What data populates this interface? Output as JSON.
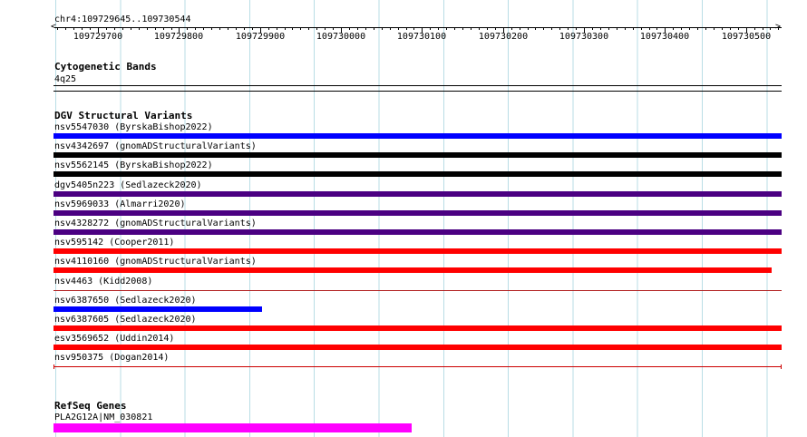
{
  "ruler": {
    "location": "chr4:109729645..109730544",
    "start": 109729645,
    "end": 109730544,
    "tick_labels": [
      "109729700",
      "109729800",
      "109729900",
      "109730000",
      "109730100",
      "109730200",
      "109730300",
      "109730400",
      "109730500"
    ],
    "tick_values": [
      109729700,
      109729800,
      109729900,
      109730000,
      109730100,
      109730200,
      109730300,
      109730400,
      109730500
    ]
  },
  "cytobands": {
    "title": "Cytogenetic Bands",
    "band": "4q25"
  },
  "dgv": {
    "title": "DGV Structural Variants",
    "variants": [
      {
        "label": "nsv5547030 (ByrskaBishop2022)",
        "color": "#0000ff",
        "style": "thick",
        "start_frac": 0.0,
        "end_frac": 1.0
      },
      {
        "label": "nsv4342697 (gnomADStructuralVariants)",
        "color": "#000000",
        "style": "thick",
        "start_frac": 0.0,
        "end_frac": 1.0
      },
      {
        "label": "nsv5562145 (ByrskaBishop2022)",
        "color": "#000000",
        "style": "thick",
        "start_frac": 0.0,
        "end_frac": 1.0
      },
      {
        "label": "dgv5405n223 (Sedlazeck2020)",
        "color": "#4b0082",
        "style": "thick",
        "start_frac": 0.0,
        "end_frac": 1.0
      },
      {
        "label": "nsv5969033 (Almarri2020)",
        "color": "#4b0082",
        "style": "thick",
        "start_frac": 0.0,
        "end_frac": 1.0
      },
      {
        "label": "nsv4328272 (gnomADStructuralVariants)",
        "color": "#4b0082",
        "style": "thick",
        "start_frac": 0.0,
        "end_frac": 1.0
      },
      {
        "label": "nsv595142 (Cooper2011)",
        "color": "#ff0000",
        "style": "thick",
        "start_frac": 0.0,
        "end_frac": 1.0
      },
      {
        "label": "nsv4110160 (gnomADStructuralVariants)",
        "color": "#ff0000",
        "style": "thick",
        "start_frac": 0.0,
        "end_frac": 0.986
      },
      {
        "label": "nsv4463 (Kidd2008)",
        "color": "#b22222",
        "style": "thin",
        "start_frac": 0.0,
        "end_frac": 1.0
      },
      {
        "label": "nsv6387650 (Sedlazeck2020)",
        "color": "#0000ff",
        "style": "thick",
        "start_frac": 0.0,
        "end_frac": 0.286
      },
      {
        "label": "nsv6387605 (Sedlazeck2020)",
        "color": "#ff0000",
        "style": "thick",
        "start_frac": 0.0,
        "end_frac": 1.0
      },
      {
        "label": "esv3569652 (Uddin2014)",
        "color": "#ff0000",
        "style": "thick",
        "start_frac": 0.0,
        "end_frac": 1.0
      },
      {
        "label": "nsv950375 (Dogan2014)",
        "color": "#cc0000",
        "style": "capped",
        "start_frac": 0.0,
        "end_frac": 1.0
      }
    ]
  },
  "refseq": {
    "title": "RefSeq Genes",
    "genes": [
      {
        "label": "PLA2G12A|NM_030821",
        "color": "#ff00ff",
        "start_frac": 0.0,
        "end_frac": 0.492
      }
    ]
  }
}
